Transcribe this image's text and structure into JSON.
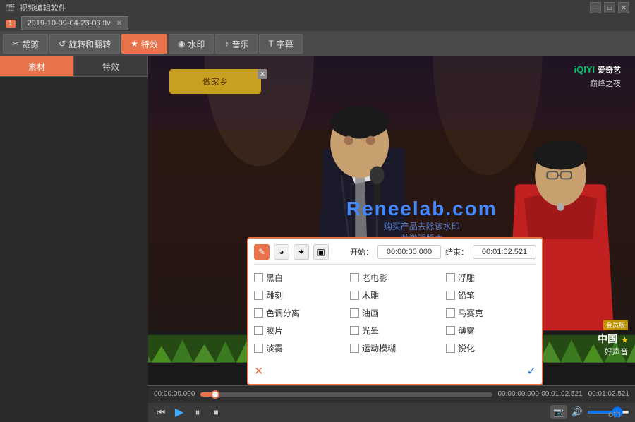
{
  "app": {
    "title": "视频编辑软件",
    "min_btn": "—",
    "max_btn": "□",
    "close_btn": "✕"
  },
  "file_tab": {
    "filename": "2019-10-09-04-23-03.flv",
    "close": "✕"
  },
  "toolbar": {
    "items": [
      {
        "label": "裁剪",
        "icon": "✂",
        "active": false
      },
      {
        "label": "旋转和翻转",
        "icon": "↺",
        "active": false
      },
      {
        "label": "特效",
        "icon": "★",
        "active": true
      },
      {
        "label": "水印",
        "icon": "◉",
        "active": false
      },
      {
        "label": "音乐",
        "icon": "♪",
        "active": false
      },
      {
        "label": "字幕",
        "icon": "T",
        "active": false
      }
    ]
  },
  "sidebar": {
    "tabs": [
      {
        "label": "素材",
        "active": true
      },
      {
        "label": "特效",
        "active": false
      }
    ]
  },
  "video": {
    "iqiyi_logo": "iQIYI 爱奇艺",
    "peak_night": "巅峰之夜",
    "ad_text": "做家乡",
    "watermark_line1": "Reneelab.com",
    "watermark_line2": "购买产品去除该水印",
    "watermark_line3": "并激活版本",
    "right_badge": "会员版",
    "right_title": "中国",
    "right_sub": "好声音"
  },
  "timeline": {
    "current": "00:00:00.000",
    "range": "00:00:00.000-00:01:02.521",
    "total": "00:01:02.521"
  },
  "controls": {
    "prev": "⏮",
    "play": "▶",
    "pause": "⏸",
    "stop": "■"
  },
  "effects_panel": {
    "tools": [
      {
        "icon": "✎",
        "active": true
      },
      {
        "icon": "◕",
        "active": false
      },
      {
        "icon": "✦",
        "active": false
      },
      {
        "icon": "▣",
        "active": false
      }
    ],
    "start_label": "开始：",
    "start_value": "00:00:00.000",
    "end_label": "结束：",
    "end_value": "00:01:02.521",
    "effects": [
      {
        "label": "黑白",
        "checked": false
      },
      {
        "label": "铅笔",
        "checked": false
      },
      {
        "label": "光晕",
        "checked": false
      },
      {
        "label": "老电影",
        "checked": false
      },
      {
        "label": "色调分离",
        "checked": false
      },
      {
        "label": "薄雾",
        "checked": false
      },
      {
        "label": "浮雕",
        "checked": false
      },
      {
        "label": "油画",
        "checked": false
      },
      {
        "label": "淡雾",
        "checked": false
      },
      {
        "label": "雕刻",
        "checked": false
      },
      {
        "label": "马赛克",
        "checked": false
      },
      {
        "label": "运动模糊",
        "checked": false
      },
      {
        "label": "木雕",
        "checked": false
      },
      {
        "label": "胶片",
        "checked": false
      },
      {
        "label": "锐化",
        "checked": false
      }
    ],
    "cancel": "✕",
    "confirm": "✓"
  },
  "bottom_text": "oth"
}
